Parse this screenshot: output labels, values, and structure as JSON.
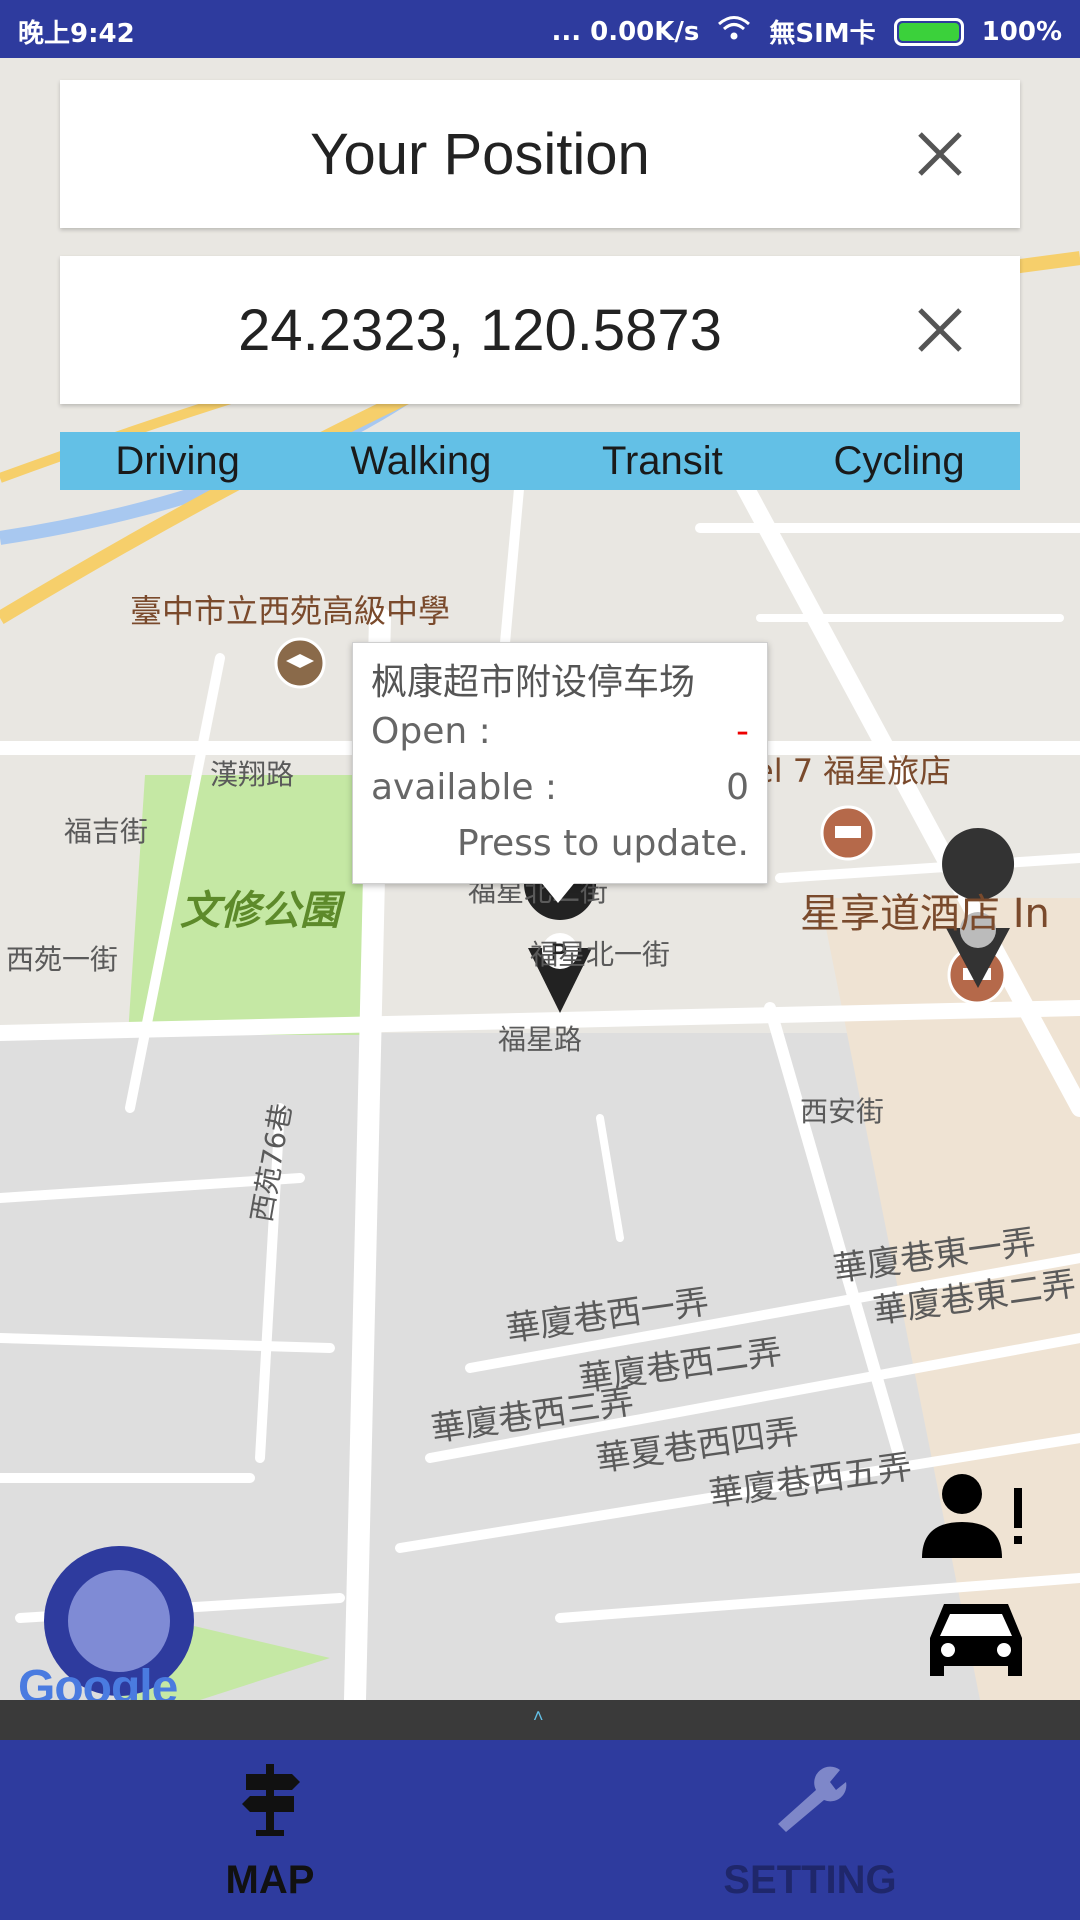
{
  "status_bar": {
    "time": "晚上9:42",
    "network_speed": "... 0.00K/s",
    "sim": "無SIM卡",
    "battery": "100%"
  },
  "origin": {
    "label": "Your Position"
  },
  "destination": {
    "value": "24.2323, 120.5873"
  },
  "travel_modes": [
    "Driving",
    "Walking",
    "Transit",
    "Cycling"
  ],
  "callout": {
    "title": "枫康超市附设停车场",
    "open_label": "Open :",
    "open_value": "-",
    "available_label": "available :",
    "available_value": "0",
    "action": "Press to update."
  },
  "map_labels": {
    "school": "臺中市立西苑高級中學",
    "hotel1": "el 7 福星旅店",
    "hotel2": "星享道酒店 In",
    "park": "文修公園",
    "road_hanxiang": "漢翔路",
    "road_fuji": "福吉街",
    "road_xiyuan1": "西苑一街",
    "road_fuxingbei1": "福星北一街",
    "road_fuxingbei2": "福星北二街",
    "road_fuxing": "福星路",
    "road_xian": "西安街",
    "road_xiyuan76": "西苑76巷",
    "lane_west1": "華廈巷西一弄",
    "lane_west2": "華廈巷西二弄",
    "lane_west3": "華廈巷西三弄",
    "lane_west4": "華夏巷西四弄",
    "lane_west5": "華廈巷西五弄",
    "lane_east1": "華廈巷東一弄",
    "lane_east2": "華廈巷東二弄",
    "google": "Google"
  },
  "bottom_nav": [
    {
      "label": "MAP",
      "icon": "signpost-icon",
      "color": "#111111"
    },
    {
      "label": "SETTING",
      "icon": "wrench-icon",
      "color": "#1f276b"
    }
  ],
  "colors": {
    "primary": "#2e3b9e",
    "mode_bar": "#63c0e6",
    "fab_inner": "#7f8bd5"
  }
}
